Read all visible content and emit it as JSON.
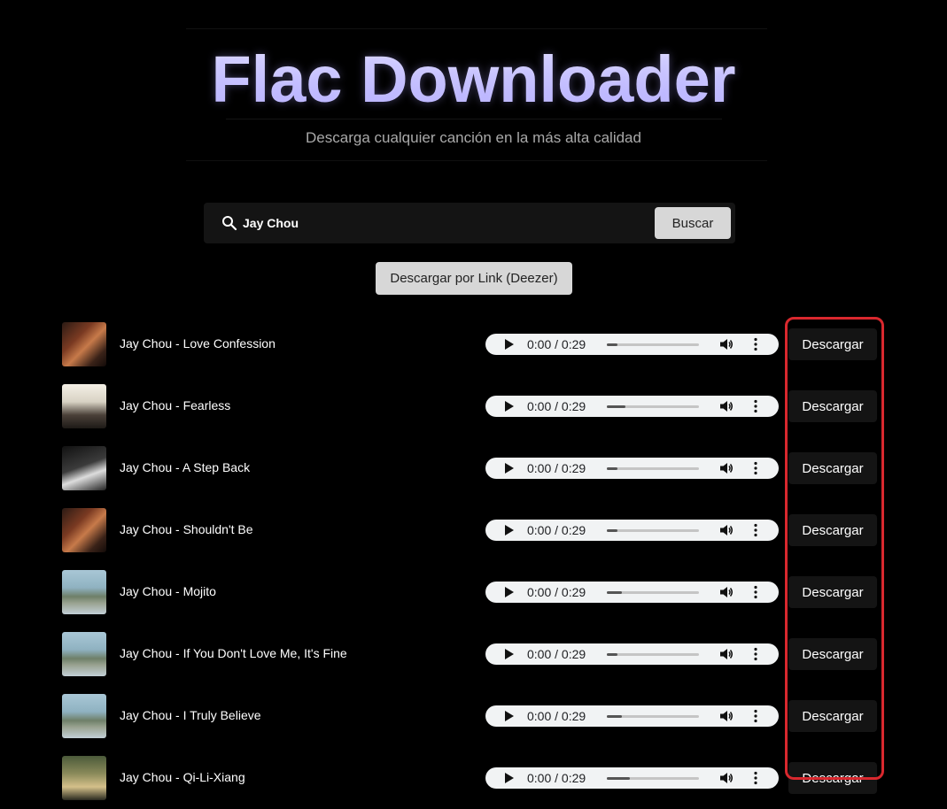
{
  "header": {
    "title": "Flac Downloader",
    "subtitle": "Descarga cualquier canción en la más alta calidad"
  },
  "search": {
    "value": "Jay Chou",
    "button_label": "Buscar",
    "icon": "search-icon"
  },
  "link_button_label": "Descargar por Link (Deezer)",
  "colors": {
    "background": "#000000",
    "title": "#c8c4ff",
    "button_light": "#d7d7d7",
    "button_dark": "#141414",
    "highlight": "#d9282e"
  },
  "results": [
    {
      "title": "Jay Chou - Love Confession",
      "time": "0:00 / 0:29",
      "progress": 0.12,
      "download_label": "Descargar"
    },
    {
      "title": "Jay Chou - Fearless",
      "time": "0:00 / 0:29",
      "progress": 0.2,
      "download_label": "Descargar"
    },
    {
      "title": "Jay Chou - A Step Back",
      "time": "0:00 / 0:29",
      "progress": 0.12,
      "download_label": "Descargar"
    },
    {
      "title": "Jay Chou - Shouldn't Be",
      "time": "0:00 / 0:29",
      "progress": 0.12,
      "download_label": "Descargar"
    },
    {
      "title": "Jay Chou - Mojito",
      "time": "0:00 / 0:29",
      "progress": 0.16,
      "download_label": "Descargar"
    },
    {
      "title": "Jay Chou - If You Don't Love Me, It's Fine",
      "time": "0:00 / 0:29",
      "progress": 0.12,
      "download_label": "Descargar"
    },
    {
      "title": "Jay Chou - I Truly Believe",
      "time": "0:00 / 0:29",
      "progress": 0.16,
      "download_label": "Descargar"
    },
    {
      "title": "Jay Chou - Qi-Li-Xiang",
      "time": "0:00 / 0:29",
      "progress": 0.25,
      "download_label": "Descargar"
    }
  ]
}
